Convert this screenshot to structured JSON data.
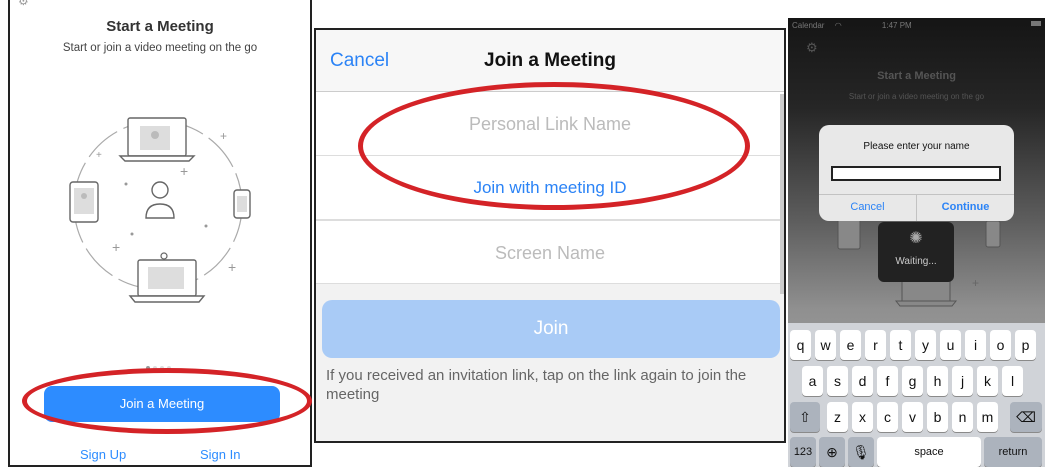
{
  "panel1": {
    "title": "Start a Meeting",
    "subtitle": "Start or join a video meeting on the go",
    "join_label": "Join a Meeting",
    "signup_label": "Sign Up",
    "signin_label": "Sign In",
    "active_page_dot": 1,
    "page_dot_count": 4
  },
  "panel2": {
    "cancel_label": "Cancel",
    "title": "Join a Meeting",
    "personal_link_placeholder": "Personal Link Name",
    "join_with_id_label": "Join with meeting ID",
    "screen_name_placeholder": "Screen Name",
    "join_button_label": "Join",
    "help_text": "If you received an invitation link, tap on the link again to join the meeting"
  },
  "panel3": {
    "status_carrier": "Calendar",
    "status_time": "1:47 PM",
    "title": "Start a Meeting",
    "subtitle": "Start or join a video meeting on the go",
    "dialog_prompt": "Please enter your name",
    "dialog_cancel": "Cancel",
    "dialog_continue": "Continue",
    "waiting_label": "Waiting...",
    "keyboard": {
      "row1": [
        "q",
        "w",
        "e",
        "r",
        "t",
        "y",
        "u",
        "i",
        "o",
        "p"
      ],
      "row2": [
        "a",
        "s",
        "d",
        "f",
        "g",
        "h",
        "j",
        "k",
        "l"
      ],
      "row3": [
        "z",
        "x",
        "c",
        "v",
        "b",
        "n",
        "m"
      ],
      "numbers_key": "123",
      "space_key": "space",
      "return_key": "return"
    }
  },
  "colors": {
    "zoom_blue": "#2d8cff",
    "link_blue": "#2b83f6",
    "annotation_red": "#d42327"
  }
}
